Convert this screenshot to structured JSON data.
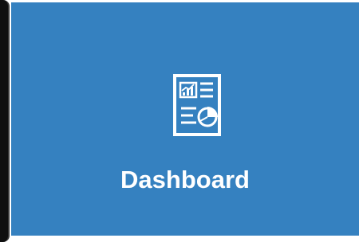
{
  "tile": {
    "label": "Dashboard",
    "icon": "report-dashboard-icon",
    "background": "#3581c0",
    "text_color": "#ffffff"
  }
}
